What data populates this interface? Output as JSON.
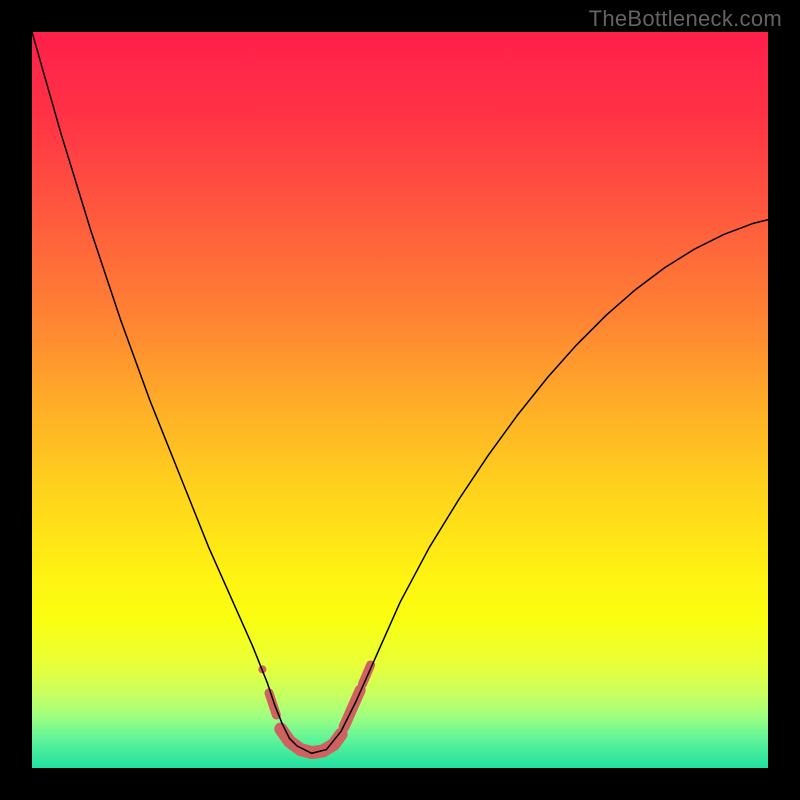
{
  "watermark": "TheBottleneck.com",
  "chart_data": {
    "type": "line",
    "title": "",
    "xlabel": "",
    "ylabel": "",
    "xlim": [
      0,
      100
    ],
    "ylim": [
      0,
      100
    ],
    "background": {
      "type": "vertical-gradient",
      "stops": [
        {
          "pos": 0.0,
          "color": "#ff1f4b"
        },
        {
          "pos": 0.12,
          "color": "#ff3445"
        },
        {
          "pos": 0.25,
          "color": "#ff5a3e"
        },
        {
          "pos": 0.38,
          "color": "#ff8034"
        },
        {
          "pos": 0.5,
          "color": "#ffab28"
        },
        {
          "pos": 0.62,
          "color": "#ffd21d"
        },
        {
          "pos": 0.74,
          "color": "#fff312"
        },
        {
          "pos": 0.8,
          "color": "#faff10"
        },
        {
          "pos": 0.86,
          "color": "#e8ff3a"
        },
        {
          "pos": 0.9,
          "color": "#c8ff60"
        },
        {
          "pos": 0.93,
          "color": "#9fff80"
        },
        {
          "pos": 0.96,
          "color": "#60f598"
        },
        {
          "pos": 1.0,
          "color": "#20e0a0"
        }
      ]
    },
    "series": [
      {
        "name": "bottleneck-curve",
        "color": "#000000",
        "width": 1.5,
        "x": [
          0.0,
          2,
          4,
          6,
          8,
          10,
          12,
          14,
          16,
          18,
          20,
          22,
          24,
          26,
          28,
          30,
          32,
          33,
          34,
          35,
          36,
          38,
          40,
          42,
          44,
          46,
          48,
          50,
          54,
          58,
          62,
          66,
          70,
          74,
          78,
          82,
          86,
          90,
          94,
          98,
          100
        ],
        "y": [
          100,
          93,
          86,
          79.5,
          73,
          67,
          61,
          55.5,
          50,
          45,
          40,
          35,
          30,
          25.5,
          21,
          16.5,
          11.5,
          8.5,
          6,
          4,
          3,
          2,
          2.5,
          5,
          9,
          13.5,
          18,
          22.5,
          30,
          36.5,
          42.5,
          48,
          53,
          57.5,
          61.5,
          65,
          68,
          70.5,
          72.5,
          74,
          74.5
        ]
      }
    ],
    "highlight_band": {
      "name": "optimal-region",
      "color": "#cf6260",
      "segments": [
        {
          "type": "line",
          "x": [
            32.2,
            33.2
          ],
          "y": [
            10.2,
            7.2
          ],
          "width": 9
        },
        {
          "type": "circle",
          "cx": 31.3,
          "cy": 13.4,
          "r": 4
        },
        {
          "type": "line",
          "x": [
            33.8,
            35.0,
            36.5,
            38.0,
            39.5,
            41.0,
            42.0
          ],
          "y": [
            5.3,
            3.6,
            2.5,
            2.1,
            2.3,
            3.2,
            4.6
          ],
          "width": 13
        },
        {
          "type": "line",
          "x": [
            42.4,
            44.6
          ],
          "y": [
            5.6,
            10.6
          ],
          "width": 11
        },
        {
          "type": "line",
          "x": [
            44.9,
            46.0
          ],
          "y": [
            11.4,
            14.0
          ],
          "width": 9
        }
      ]
    }
  }
}
